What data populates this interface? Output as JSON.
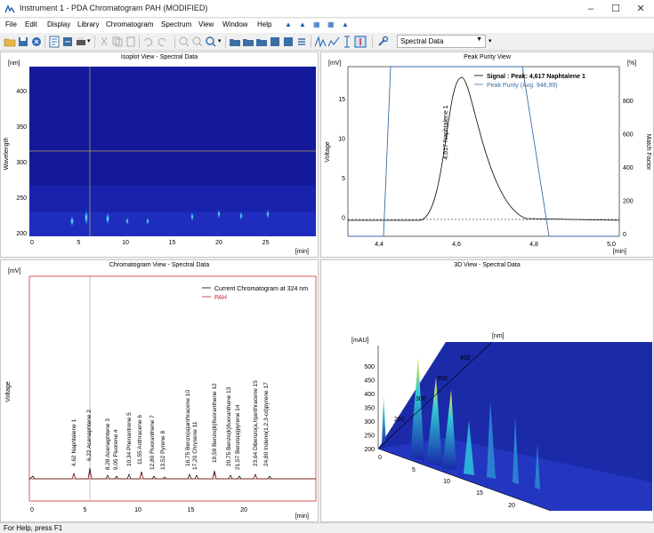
{
  "window": {
    "title": "Instrument 1 - PDA Chromatogram  PAH (MODIFIED)"
  },
  "menu": [
    "File",
    "Edit",
    "Display",
    "Library",
    "Chromatogram",
    "Spectrum",
    "View",
    "Window",
    "Help"
  ],
  "toolbar": {
    "combo_value": "Spectral Data"
  },
  "isoplot": {
    "title": "Isoplot View - Spectral Data",
    "unit_y": "[nm]",
    "unit_x": "[min]",
    "ylabel": "Wavelength",
    "yticks": [
      "400",
      "350",
      "300",
      "250",
      "200"
    ],
    "xticks": [
      "0",
      "5",
      "10",
      "15",
      "20",
      "25"
    ]
  },
  "purity": {
    "title": "Peak Purity View",
    "unit_left": "[mV]",
    "unit_right": "[%]",
    "unit_x": "[min]",
    "ylabel_left": "Voltage",
    "ylabel_right": "Match Factor",
    "yticks_left": [
      "15",
      "10",
      "5",
      "0"
    ],
    "yticks_right": [
      "800",
      "600",
      "400",
      "200",
      "0"
    ],
    "xticks": [
      "4,4",
      "4,6",
      "4,8",
      "5,0"
    ],
    "legend_signal": "Signal : Peak: 4,617 Naphtalene  1",
    "legend_purity": "Peak Purity (Avg. 946,99)",
    "peak_label": "4,617 Naphtalene  1"
  },
  "chrom": {
    "title": "Chromatogram View - Spectral Data",
    "unit_y": "[mV]",
    "unit_x": "[min]",
    "ylabel": "Voltage",
    "xticks": [
      "0",
      "5",
      "10",
      "15",
      "20"
    ],
    "legend_current": "Current Chromatogram at 324 nm",
    "legend_pah": "PAH",
    "peak_labels": [
      "4,62 Naphtalene  1",
      "6,22 Acenaphtene  2",
      "8,28 Acenaphtene  3",
      "9,05 Fluorene  4",
      "10,34 Phenantrene  5",
      "11,55 Anthracene  6",
      "12,80 Fluoranthene  7",
      "13,52 Pyrene  8",
      "16,75 Benzo(a)anthracene  10",
      "17,20 Chrysene  11",
      "19,59 Benzo(b)fluoranthene  12",
      "20,75 Benzo(k)fluoranthene  13",
      "21,57 Benzo(a)pyrene  14",
      "23,64 Dibenzo(a,h)anthracene  15",
      "24,80 Indeno(1,2,3-cd)pyrene  17"
    ]
  },
  "view3d": {
    "title": "3D View - Spectral Data",
    "unit_z": "[mAU]",
    "unit_nm": "[nm]",
    "zticks": [
      "500",
      "450",
      "400",
      "350",
      "300",
      "250",
      "200"
    ],
    "nmticks": [
      "400",
      "350",
      "300",
      "250"
    ],
    "xticks": [
      "0",
      "5",
      "10",
      "15",
      "20"
    ]
  },
  "status": {
    "text": "For Help, press F1"
  }
}
